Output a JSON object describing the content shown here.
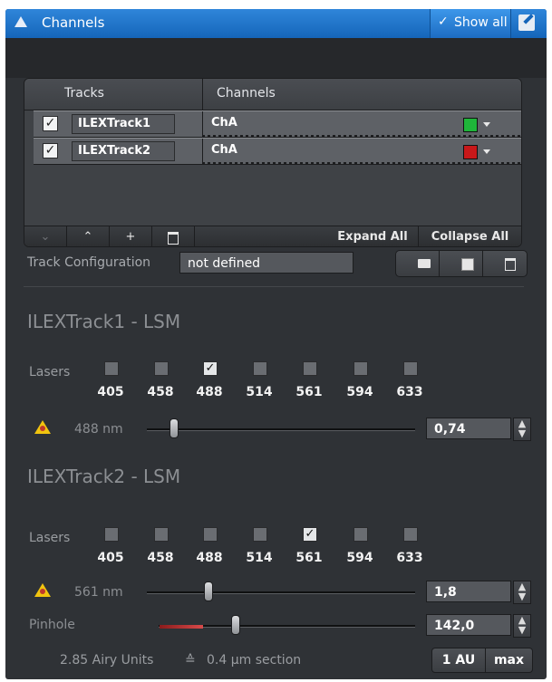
{
  "panel": {
    "title": "Channels",
    "show_all_check": "✓",
    "show_all_label": "Show all"
  },
  "tracks_table": {
    "headers": [
      "Tracks",
      "Channels"
    ],
    "rows": [
      {
        "checked": "✓",
        "track": "ILEXTrack1",
        "channel": "ChA",
        "color": "#1fb53a"
      },
      {
        "checked": "✓",
        "track": "ILEXTrack2",
        "channel": "ChA",
        "color": "#c8181a"
      }
    ],
    "toolbar": {
      "down": "⌄",
      "up": "⌃",
      "add": "+",
      "delete": "🗑",
      "expand_all": "Expand All",
      "collapse_all": "Collapse All"
    }
  },
  "track_config": {
    "label": "Track Configuration",
    "value": "not defined"
  },
  "lsm1": {
    "title": "ILEXTrack1 - LSM",
    "lasers_label": "Lasers",
    "wavelengths": [
      "405",
      "458",
      "488",
      "514",
      "561",
      "594",
      "633"
    ],
    "checked": [
      "",
      "",
      "✓",
      "",
      "",
      "",
      ""
    ],
    "active_label": "488 nm",
    "power": "0,74",
    "slider_fraction": 0.07
  },
  "lsm2": {
    "title": "ILEXTrack2 - LSM",
    "lasers_label": "Lasers",
    "wavelengths": [
      "405",
      "458",
      "488",
      "514",
      "561",
      "594",
      "633"
    ],
    "checked": [
      "",
      "",
      "",
      "",
      "✓",
      "",
      ""
    ],
    "active_label": "561 nm",
    "power": "1,8",
    "slider_fraction": 0.22,
    "pinhole_label": "Pinhole",
    "pinhole_value": "142,0",
    "airy_units": "2.85 Airy Units",
    "section_symbol": "≙",
    "section": "0.4 µm section",
    "au_button": "1 AU",
    "max_button": "max"
  },
  "colors": {
    "title_bar": "#1565b9",
    "panel_bg": "#2f3236",
    "warning": "#f1c40f"
  }
}
